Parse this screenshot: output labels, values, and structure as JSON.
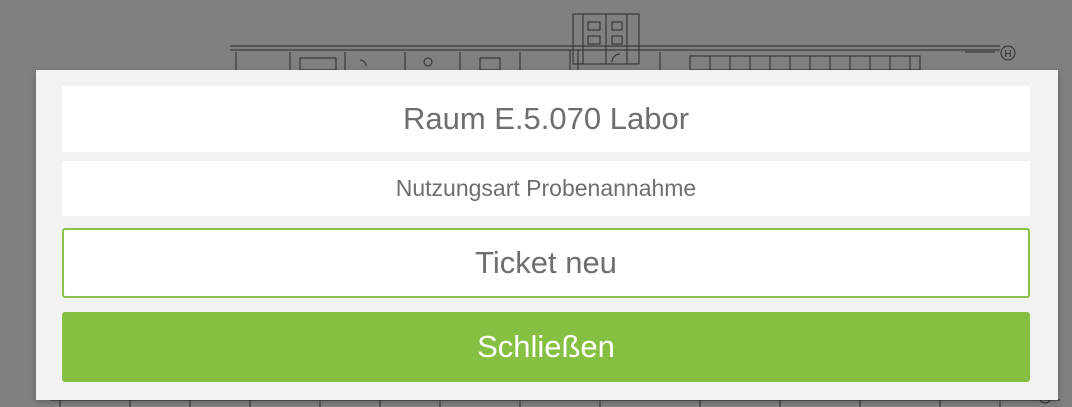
{
  "background": {
    "axis_marker": "H",
    "colors": {
      "overlay": "#808080",
      "lines": "#2a2a2a"
    }
  },
  "dialog": {
    "room_title": "Raum E.5.070 Labor",
    "usage_type": "Nutzungsart Probenannahme",
    "ticket_button_label": "Ticket neu",
    "close_button_label": "Schließen",
    "colors": {
      "accent": "#86c043",
      "text": "#6e6e6e",
      "panel": "#f2f2f2"
    }
  }
}
